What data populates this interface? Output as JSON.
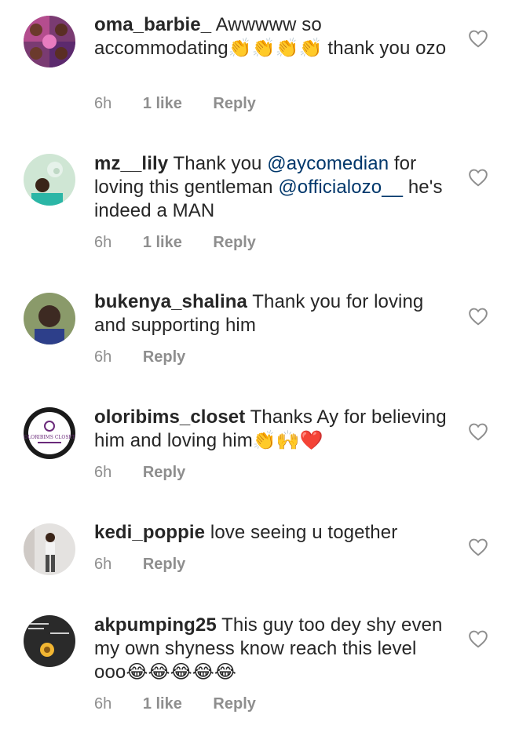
{
  "comments": [
    {
      "username": "oma_barbie_",
      "text_before": "Awwwww so accommodating",
      "emoji": "👏👏👏👏",
      "text_after": " thank you ozo",
      "time": "6h",
      "likes": "1 like",
      "reply": "Reply"
    },
    {
      "username": "mz__lily",
      "text_1": "Thank you ",
      "mention_1": "@aycomedian",
      "text_2": " for loving this gentleman ",
      "mention_2": "@officialozo__",
      "text_3": " he's indeed a MAN",
      "time": "6h",
      "likes": "1 like",
      "reply": "Reply"
    },
    {
      "username": "bukenya_shalina",
      "text": "Thank you for loving and supporting him",
      "time": "6h",
      "reply": "Reply"
    },
    {
      "username": "oloribims_closet",
      "text": "Thanks Ay for believing him and loving him",
      "emoji": "👏🙌❤️",
      "avatar_logo_text": "OLORIBIMS CLOSET",
      "time": "6h",
      "reply": "Reply"
    },
    {
      "username": "kedi_poppie",
      "text": "love seeing u together",
      "time": "6h",
      "reply": "Reply"
    },
    {
      "username": "akpumping25",
      "text": "This guy too dey  shy even my own shyness know reach this level ooo",
      "emoji": "😂😂😂😂😂",
      "time": "6h",
      "likes": "1 like",
      "reply": "Reply"
    }
  ],
  "colors": {
    "text": "#262626",
    "meta": "#8e8e8e",
    "mention": "#00376b"
  },
  "icons": {
    "like": "heart-outline-icon"
  }
}
